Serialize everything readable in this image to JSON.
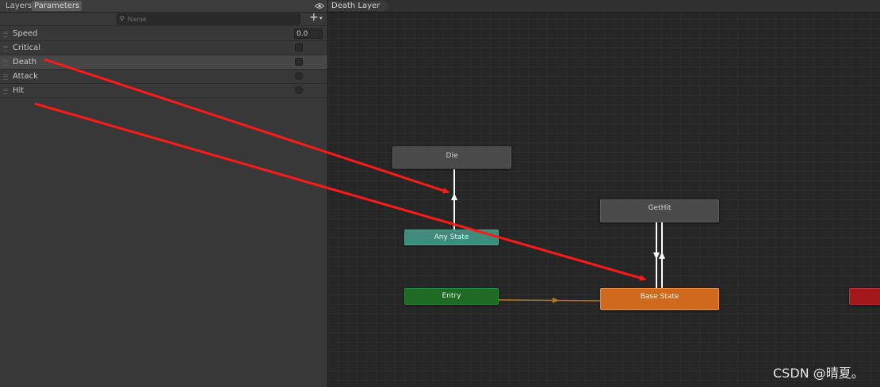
{
  "toolbar": {
    "tabs": [
      {
        "label": "Layers",
        "active": false
      },
      {
        "label": "Parameters",
        "active": true
      }
    ],
    "visibility_icon": "eye-icon"
  },
  "search": {
    "placeholder": "Name",
    "value": "",
    "icon": "search-icon",
    "add_label": "+",
    "add_caret": "▾"
  },
  "parameters": [
    {
      "name": "Speed",
      "type": "float",
      "value": "0.0"
    },
    {
      "name": "Critical",
      "type": "bool",
      "value": false
    },
    {
      "name": "Death",
      "type": "bool",
      "value": false,
      "selected": true
    },
    {
      "name": "Attack",
      "type": "trigger"
    },
    {
      "name": "Hit",
      "type": "trigger"
    }
  ],
  "graph": {
    "breadcrumb": "Death Layer",
    "states": {
      "die": "Die",
      "get_hit": "GetHit",
      "any_state": "Any State",
      "entry": "Entry",
      "base_state": "Base State"
    },
    "colors": {
      "default_state": "#4a4a4a",
      "any_state": "#3e8c7c",
      "entry": "#1f6b25",
      "base_state": "#d0681d",
      "exit": "#a31818",
      "transition": "#ffffff",
      "entry_transition": "#b8781e",
      "annotation_arrow": "#ff1a1a"
    }
  },
  "watermark": "CSDN @晴夏。"
}
